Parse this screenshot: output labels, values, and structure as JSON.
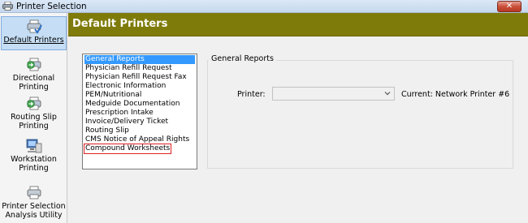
{
  "window": {
    "title": "Printer Selection",
    "close_label": "✕"
  },
  "sidebar": {
    "items": [
      {
        "name": "default-printers",
        "line1": "Default Printers",
        "line2": "",
        "icon": "printer-check-icon",
        "active": true
      },
      {
        "name": "directional-printing",
        "line1": "Directional",
        "line2": "Printing",
        "icon": "printer-arrow-icon"
      },
      {
        "name": "routing-slip-printing",
        "line1": "Routing Slip",
        "line2": "Printing",
        "icon": "printer-arrow-icon"
      },
      {
        "name": "workstation-printing",
        "line1": "Workstation",
        "line2": "Printing",
        "icon": "computer-icon"
      },
      {
        "name": "printer-selection-analysis-utility",
        "line1": "Printer Selection",
        "line2": "Analysis Utility",
        "icon": "printer-icon"
      }
    ]
  },
  "header": {
    "title": "Default Printers",
    "color": "#7f7b0a"
  },
  "report_list": {
    "items": [
      "General Reports",
      "Physician Refill Request",
      "Physician Refill Request Fax",
      "Electronic Information",
      "PEM/Nutritional",
      "Medguide Documentation",
      "Prescription Intake",
      "Invoice/Delivery Ticket",
      "Routing Slip",
      "CMS Notice of Appeal Rights",
      "Compound Worksheets"
    ],
    "selected_index": 0,
    "focused_index": 10
  },
  "group": {
    "legend": "General Reports",
    "printer_label": "Printer:",
    "printer_value": "",
    "current": "Current: Network Printer #6"
  }
}
